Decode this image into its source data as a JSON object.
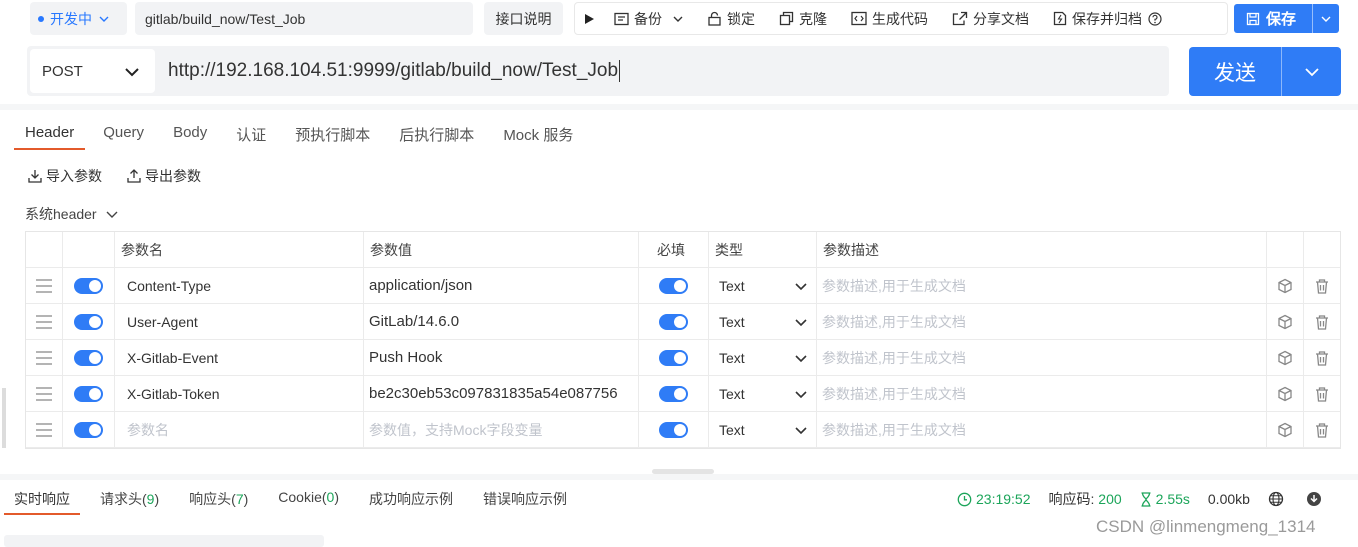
{
  "toolbar": {
    "env_label": "开发中",
    "request_name": "gitlab/build_now/Test_Job",
    "doc_button": "接口说明",
    "tools": [
      {
        "icon": "play-icon",
        "label": ""
      },
      {
        "icon": "backup-icon",
        "label": "备份"
      },
      {
        "icon": "lock-icon",
        "label": "锁定"
      },
      {
        "icon": "clone-icon",
        "label": "克隆"
      },
      {
        "icon": "code-icon",
        "label": "生成代码"
      },
      {
        "icon": "share-icon",
        "label": "分享文档"
      },
      {
        "icon": "archive-icon",
        "label": "保存并归档"
      }
    ],
    "save_label": "保存"
  },
  "request": {
    "method": "POST",
    "url": "http://192.168.104.51:9999/gitlab/build_now/Test_Job",
    "send_label": "发送"
  },
  "req_tabs": [
    "Header",
    "Query",
    "Body",
    "认证",
    "预执行脚本",
    "后执行脚本",
    "Mock 服务"
  ],
  "import_label": "导入参数",
  "export_label": "导出参数",
  "system_header_label": "系统header",
  "params_table": {
    "headers": {
      "name": "参数名",
      "value": "参数值",
      "required": "必填",
      "type": "类型",
      "desc": "参数描述"
    },
    "rows": [
      {
        "name": "Content-Type",
        "value": "application/json",
        "type": "Text",
        "desc_placeholder": "参数描述,用于生成文档"
      },
      {
        "name": "User-Agent",
        "value": "GitLab/14.6.0",
        "type": "Text",
        "desc_placeholder": "参数描述,用于生成文档"
      },
      {
        "name": "X-Gitlab-Event",
        "value": "Push Hook",
        "type": "Text",
        "desc_placeholder": "参数描述,用于生成文档"
      },
      {
        "name": "X-Gitlab-Token",
        "value": "be2c30eb53c097831835a54e087756",
        "type": "Text",
        "desc_placeholder": "参数描述,用于生成文档"
      }
    ],
    "empty_row": {
      "name_placeholder": "参数名",
      "value_placeholder": "参数值，支持Mock字段变量",
      "type": "Text",
      "desc_placeholder": "参数描述,用于生成文档"
    }
  },
  "response": {
    "tabs": [
      {
        "label": "实时响应",
        "count": ""
      },
      {
        "label": "请求头",
        "count": "9"
      },
      {
        "label": "响应头",
        "count": "7"
      },
      {
        "label": "Cookie",
        "count": "0"
      },
      {
        "label": "成功响应示例",
        "count": ""
      },
      {
        "label": "错误响应示例",
        "count": ""
      }
    ],
    "time": "23:19:52",
    "status_label": "响应码:",
    "status_code": "200",
    "duration": "2.55s",
    "size": "0.00kb"
  },
  "watermark": "CSDN @linmengmeng_1314",
  "colors": {
    "accent": "#2f7cf6",
    "tab_underline": "#e35a2b",
    "success": "#1ca55a"
  }
}
